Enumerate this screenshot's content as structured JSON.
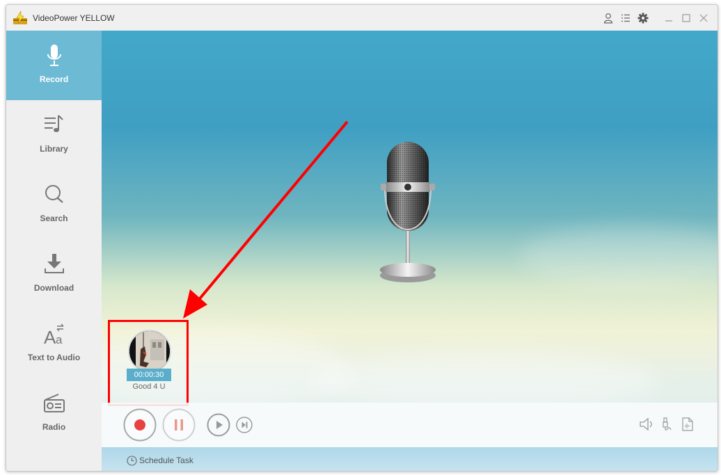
{
  "window": {
    "title": "VideoPower YELLOW",
    "titlebar_icons": [
      "user-icon",
      "menu-list-icon",
      "settings-gear-icon",
      "minimize-icon",
      "maximize-icon",
      "close-icon"
    ]
  },
  "sidebar": {
    "items": [
      {
        "label": "Record",
        "icon": "microphone-icon",
        "active": true
      },
      {
        "label": "Library",
        "icon": "music-library-icon",
        "active": false
      },
      {
        "label": "Search",
        "icon": "search-icon",
        "active": false
      },
      {
        "label": "Download",
        "icon": "download-icon",
        "active": false
      },
      {
        "label": "Text to Audio",
        "icon": "text-to-audio-icon",
        "active": false
      },
      {
        "label": "Radio",
        "icon": "radio-icon",
        "active": false
      }
    ]
  },
  "main": {
    "recording": {
      "duration": "00:00:30",
      "name": "Good 4 U"
    },
    "controls": {
      "buttons": [
        "record-button",
        "pause-button",
        "play-button",
        "skip-next-button"
      ],
      "right_icons": [
        "speaker-icon",
        "audio-input-icon",
        "audio-file-icon"
      ]
    },
    "footer": {
      "schedule_label": "Schedule Task"
    }
  },
  "colors": {
    "accent": "#6dbad5",
    "record_red": "#e84142",
    "annotation_red": "#ff0000"
  }
}
